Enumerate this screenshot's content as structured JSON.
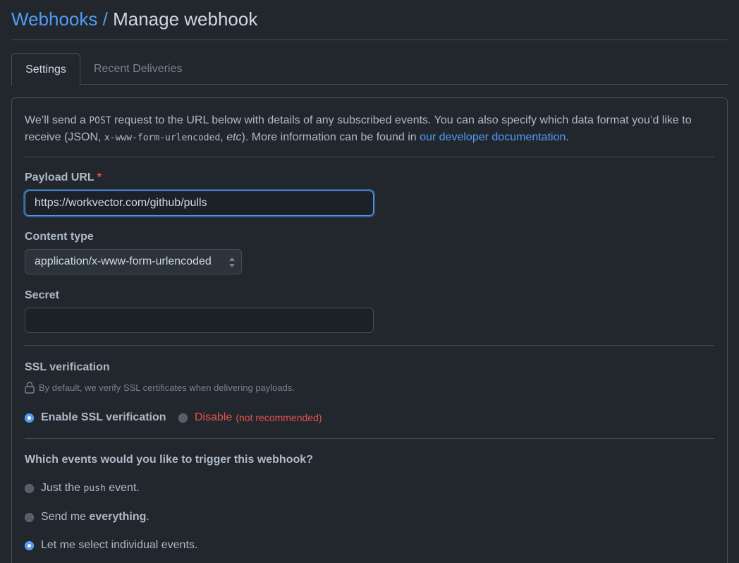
{
  "header": {
    "breadcrumb_link": "Webhooks",
    "separator": "/",
    "current": "Manage webhook"
  },
  "tabs": [
    {
      "label": "Settings",
      "active": true
    },
    {
      "label": "Recent Deliveries",
      "active": false
    }
  ],
  "intro": {
    "part1": "We’ll send a ",
    "code1": "POST",
    "part2": " request to the URL below with details of any subscribed events. You can also specify which data format you’d like to receive (JSON, ",
    "code2": "x-www-form-urlencoded",
    "part3": ", ",
    "etc": "etc",
    "part4": "). More information can be found in ",
    "link": "our developer documentation",
    "part5": "."
  },
  "payload_url": {
    "label": "Payload URL",
    "required_mark": "*",
    "value": "https://workvector.com/github/pulls"
  },
  "content_type": {
    "label": "Content type",
    "selected": "application/x-www-form-urlencoded"
  },
  "secret": {
    "label": "Secret",
    "value": ""
  },
  "ssl": {
    "label": "SSL verification",
    "note": "By default, we verify SSL certificates when delivering payloads.",
    "enable_label": "Enable SSL verification",
    "disable_label": "Disable",
    "disable_note": "(not recommended)",
    "selected": "enable"
  },
  "events": {
    "question": "Which events would you like to trigger this webhook?",
    "option1_pre": "Just the ",
    "option1_code": "push",
    "option1_post": " event.",
    "option2_pre": "Send me ",
    "option2_bold": "everything",
    "option2_post": ".",
    "option3": "Let me select individual events.",
    "selected": "individual"
  },
  "colors": {
    "accent": "#539bf5",
    "danger": "#e5534b",
    "background": "#22272e"
  }
}
